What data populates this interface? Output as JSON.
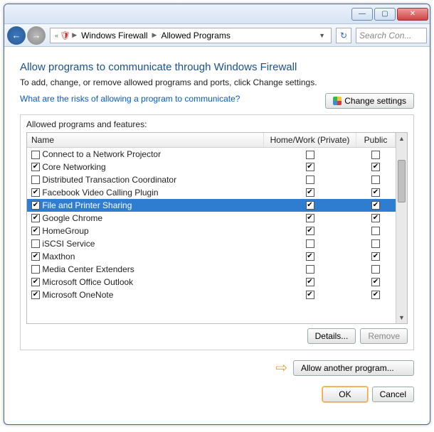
{
  "titlebar": {
    "min": "—",
    "max": "▢",
    "close": "✕"
  },
  "nav": {
    "back": "←",
    "fwd": "→",
    "bc_icon": "«",
    "bc1": "Windows Firewall",
    "bc2": "Allowed Programs",
    "refresh": "↻",
    "search_placeholder": "Search Con..."
  },
  "page": {
    "heading": "Allow programs to communicate through Windows Firewall",
    "subtext": "To add, change, or remove allowed programs and ports, click Change settings.",
    "risk_link": "What are the risks of allowing a program to communicate?",
    "change_settings": "Change settings",
    "group_label": "Allowed programs and features:",
    "col_name": "Name",
    "col_home": "Home/Work (Private)",
    "col_public": "Public",
    "details_btn": "Details...",
    "remove_btn": "Remove",
    "allow_btn": "Allow another program...",
    "ok": "OK",
    "cancel": "Cancel"
  },
  "rows": [
    {
      "name": "Connect to a Network Projector",
      "enabled": false,
      "home": false,
      "public": false,
      "selected": false
    },
    {
      "name": "Core Networking",
      "enabled": true,
      "home": true,
      "public": true,
      "selected": false
    },
    {
      "name": "Distributed Transaction Coordinator",
      "enabled": false,
      "home": false,
      "public": false,
      "selected": false
    },
    {
      "name": "Facebook Video Calling Plugin",
      "enabled": true,
      "home": true,
      "public": true,
      "selected": false
    },
    {
      "name": "File and Printer Sharing",
      "enabled": true,
      "home": true,
      "public": true,
      "selected": true
    },
    {
      "name": "Google Chrome",
      "enabled": true,
      "home": true,
      "public": true,
      "selected": false
    },
    {
      "name": "HomeGroup",
      "enabled": true,
      "home": true,
      "public": false,
      "selected": false
    },
    {
      "name": "iSCSI Service",
      "enabled": false,
      "home": false,
      "public": false,
      "selected": false
    },
    {
      "name": "Maxthon",
      "enabled": true,
      "home": true,
      "public": true,
      "selected": false
    },
    {
      "name": "Media Center Extenders",
      "enabled": false,
      "home": false,
      "public": false,
      "selected": false
    },
    {
      "name": "Microsoft Office Outlook",
      "enabled": true,
      "home": true,
      "public": true,
      "selected": false
    },
    {
      "name": "Microsoft OneNote",
      "enabled": true,
      "home": true,
      "public": true,
      "selected": false
    }
  ]
}
